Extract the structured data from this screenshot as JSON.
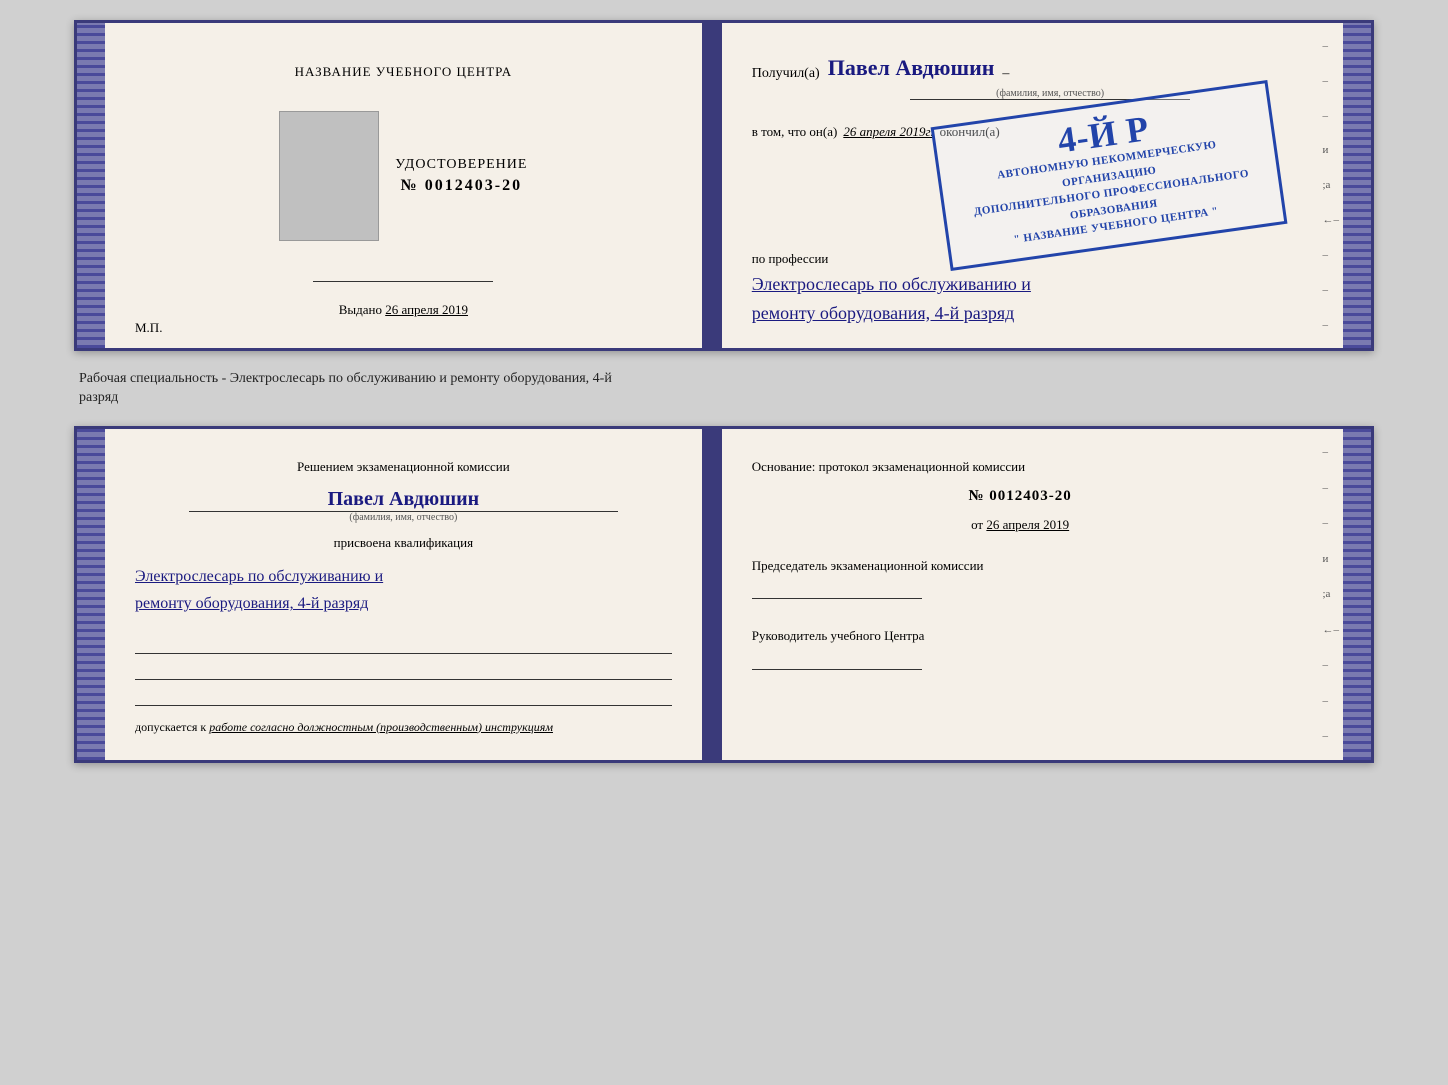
{
  "top_doc": {
    "left": {
      "title": "НАЗВАНИЕ УЧЕБНОГО ЦЕНТРА",
      "udostoverenie": "УДОСТОВЕРЕНИЕ",
      "number_prefix": "№",
      "number": "0012403-20",
      "sig_line_label": "",
      "vydano_prefix": "Выдано",
      "vydano_date": "26 апреля 2019",
      "mp_label": "М.П."
    },
    "right": {
      "poluchil": "Получил(а)",
      "name_handwritten": "Павел Авдюшин",
      "name_subtext": "(фамилия, имя, отчество)",
      "vtom_prefix": "в том, что он(а)",
      "date_italic": "26 апреля 2019г.",
      "okonchil": "окончил(а)",
      "stamp_line1": "4-й р",
      "stamp_num": "4-й",
      "stamp_body_line1": "АВТОНОМНУЮ НЕКОММЕРЧЕСКУЮ ОРГАНИЗАЦИЮ",
      "stamp_body_line2": "ДОПОЛНИТЕЛЬНОГО ПРОФЕССИОНАЛЬНОГО ОБРАЗОВАНИЯ",
      "stamp_body_line3": "\" НАЗВАНИЕ УЧЕБНОГО ЦЕНТРА \"",
      "po_professii": "по профессии",
      "profession_handwritten": "Электрослесарь по обслуживанию и",
      "profession_handwritten2": "ремонту оборудования, 4-й разряд"
    }
  },
  "between_label": {
    "text": "Рабочая специальность - Электрослесарь по обслуживанию и ремонту оборудования, 4-й",
    "text2": "разряд"
  },
  "bottom_doc": {
    "left": {
      "komissia_title": "Решением экзаменационной комиссии",
      "fio_handwritten": "Павел Авдюшин",
      "fio_subtext": "(фамилия, имя, отчество)",
      "prisvoena": "присвоена квалификация",
      "qual_handwritten": "Электрослесарь по обслуживанию и",
      "qual_handwritten2": "ремонту оборудования, 4-й разряд",
      "dopuskaetsya": "допускается к",
      "dopusk_italic": "работе согласно должностным (производственным) инструкциям"
    },
    "right": {
      "osnovanie": "Основание: протокол экзаменационной комиссии",
      "number_prefix": "№",
      "number": "0012403-20",
      "ot_prefix": "от",
      "ot_date": "26 апреля 2019",
      "predsedatel": "Председатель экзаменационной комиссии",
      "rukovoditel": "Руководитель учебного Центра"
    },
    "right_marks": [
      "-",
      "-",
      "-",
      "и",
      ";а",
      "←",
      "-",
      "-",
      "-",
      "-"
    ]
  }
}
